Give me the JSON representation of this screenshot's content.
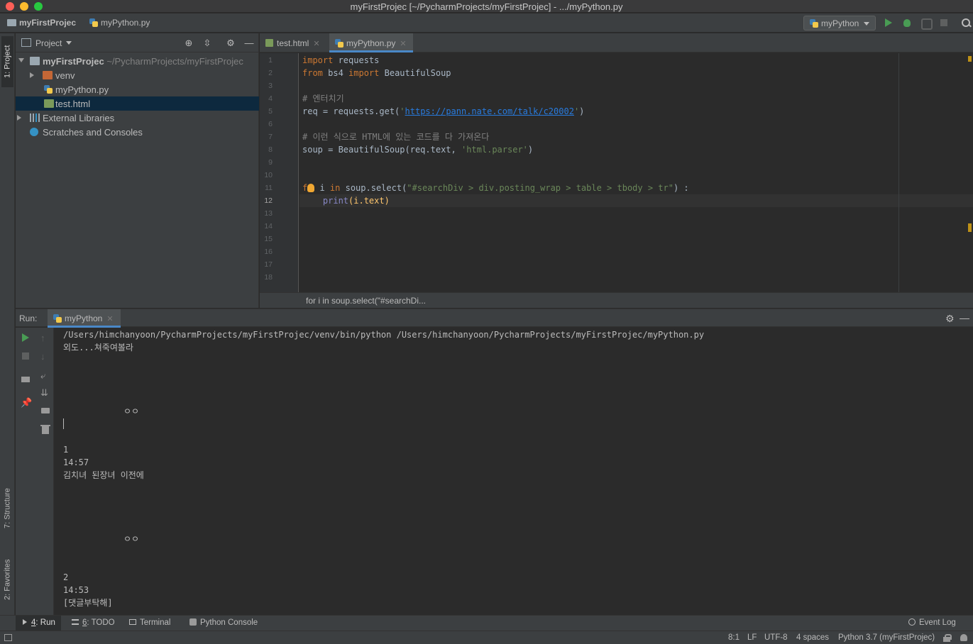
{
  "window": {
    "title": "myFirstProjec [~/PycharmProjects/myFirstProjec] - .../myPython.py"
  },
  "navbar": {
    "project": "myFirstProjec",
    "file": "myPython.py",
    "run_config": "myPython"
  },
  "sidebar": {
    "project_tab": "1: Project",
    "structure_tab": "7: Structure",
    "favorites_tab": "2: Favorites"
  },
  "project_panel": {
    "title": "Project",
    "root": {
      "name": "myFirstProjec",
      "path": "~/PycharmProjects/myFirstProjec"
    },
    "items": [
      {
        "label": "venv"
      },
      {
        "label": "myPython.py"
      },
      {
        "label": "test.html"
      },
      {
        "label": "External Libraries"
      },
      {
        "label": "Scratches and Consoles"
      }
    ]
  },
  "editor": {
    "tabs": [
      {
        "label": "test.html"
      },
      {
        "label": "myPython.py"
      }
    ],
    "line_numbers": [
      "1",
      "2",
      "3",
      "4",
      "5",
      "6",
      "7",
      "8",
      "9",
      "10",
      "11",
      "12",
      "13",
      "14",
      "15",
      "16",
      "17",
      "18"
    ],
    "current_line": 12,
    "code": {
      "l1_kw": "import",
      "l1_rest": " requests",
      "l2_kw1": "from",
      "l2_mod": " bs4 ",
      "l2_kw2": "import",
      "l2_rest": " BeautifulSoup",
      "l4_comment": "# 엔터치기",
      "l5_pre": "req = requests.get(",
      "l5_q1": "'",
      "l5_url": "https://pann.nate.com/talk/c20002",
      "l5_q2": "'",
      "l5_post": ")",
      "l7_comment": "# 이런 식으로 HTML에 있는 코드를 다 가져온다",
      "l8_pre": "soup = BeautifulSoup(req.text, ",
      "l8_str": "'html.parser'",
      "l8_post": ")",
      "l11_f": "f",
      "l11_kw": " in",
      "l11_mid": " soup.select(",
      "l11_str": "\"#searchDiv > div.posting_wrap > table > tbody > tr\"",
      "l11_post": ") :",
      "l11_i": " i",
      "l12_fn": "print",
      "l12_rest": "(i.text)"
    },
    "breadcrumb": "for i in soup.select(\"#searchDi..."
  },
  "run_panel": {
    "label": "Run:",
    "tab": "myPython",
    "output": [
      "/Users/himchanyoon/PycharmProjects/myFirstProjec/venv/bin/python /Users/himchanyoon/PycharmProjects/myFirstProjec/myPython.py",
      "외도...쳐죽여볼라",
      "ㅇㅇ",
      "1",
      "14:57",
      "김치녀 된장녀 이전에",
      "ㅇㅇ",
      "2",
      "14:53",
      "[댓글부탁해]"
    ]
  },
  "bottom_tools": {
    "run_num": "4",
    "run": ": Run",
    "todo_num": "6",
    "todo": ": TODO",
    "terminal": "Terminal",
    "python_console": "Python Console",
    "event_log": "Event Log"
  },
  "status_bar": {
    "position": "8:1",
    "line_sep": "LF",
    "encoding": "UTF-8",
    "indent": "4 spaces",
    "interpreter": "Python 3.7 (myFirstProjec)"
  }
}
